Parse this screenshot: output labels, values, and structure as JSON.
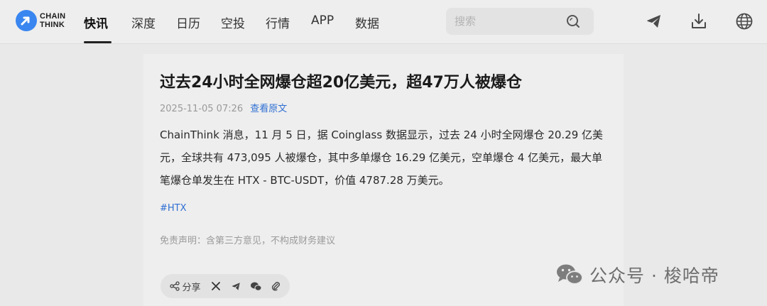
{
  "brand": {
    "logo_line1": "CHAIN",
    "logo_line2": "THINK"
  },
  "nav": {
    "items": [
      {
        "label": "快讯"
      },
      {
        "label": "深度"
      },
      {
        "label": "日历"
      },
      {
        "label": "空投"
      },
      {
        "label": "行情"
      },
      {
        "label": "APP"
      },
      {
        "label": "数据"
      }
    ],
    "active_index": 0
  },
  "search": {
    "placeholder": "搜索",
    "value": ""
  },
  "header_icons": [
    "telegram-icon",
    "download-icon",
    "globe-icon"
  ],
  "article": {
    "title": "过去24小时全网爆仓超20亿美元，超47万人被爆仓",
    "date": "2025-11-05 07:26",
    "source_link": "查看原文",
    "body": "ChainThink 消息，11 月 5 日，据 Coinglass 数据显示，过去 24 小时全网爆仓 20.29 亿美元，全球共有 473,095 人被爆仓，其中多单爆仓 16.29 亿美元，空单爆仓 4 亿美元，最大单笔爆仓单发生在 HTX - BTC-USDT，价值 4787.28 万美元。",
    "tag": "#HTX",
    "disclaimer": "免责声明：含第三方意见，不构成财务建议"
  },
  "share": {
    "label": "分享",
    "targets": [
      "x-icon",
      "telegram-icon",
      "wechat-icon",
      "link-icon"
    ]
  },
  "watermark": {
    "text": "公众号 · 梭哈帝"
  },
  "colors": {
    "accent": "#2f6fd3",
    "logo": "#3a86f0",
    "background": "#e9e9e9"
  }
}
